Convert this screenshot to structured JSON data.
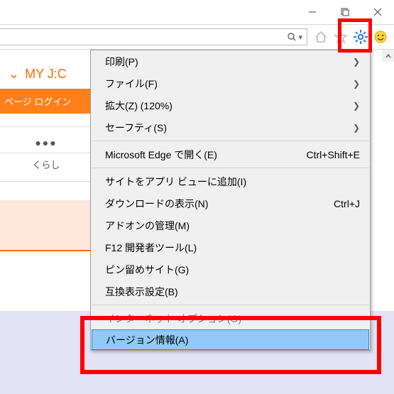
{
  "window": {
    "minimize": "—",
    "maximize": "❐",
    "close": "✕"
  },
  "toolbar": {
    "home": "home",
    "star": "star",
    "gear": "gear",
    "smiley": "smiley"
  },
  "page": {
    "tab_chevron": "⌄",
    "tab_title": "MY J:C",
    "orange_bar": "ページ ログイン",
    "dots": "●●●",
    "kurashi": "くらし"
  },
  "menu": {
    "items": [
      {
        "label": "印刷(P)",
        "submenu": true
      },
      {
        "label": "ファイル(F)",
        "submenu": true
      },
      {
        "label": "拡大(Z) (120%)",
        "submenu": true
      },
      {
        "label": "セーフティ(S)",
        "submenu": true
      }
    ],
    "group2": [
      {
        "label": "Microsoft Edge で開く(E)",
        "shortcut": "Ctrl+Shift+E"
      }
    ],
    "group3": [
      {
        "label": "サイトをアプリ ビューに追加(I)"
      },
      {
        "label": "ダウンロードの表示(N)",
        "shortcut": "Ctrl+J"
      },
      {
        "label": "アドオンの管理(M)"
      },
      {
        "label": "F12 開発者ツール(L)"
      },
      {
        "label": "ピン留めサイト(G)"
      },
      {
        "label": "互換表示設定(B)"
      }
    ],
    "group4": [
      {
        "label": "インターネット オプション(O)",
        "strike": true
      },
      {
        "label": "バージョン情報(A)",
        "selected": true
      }
    ],
    "arrow": "❯"
  }
}
